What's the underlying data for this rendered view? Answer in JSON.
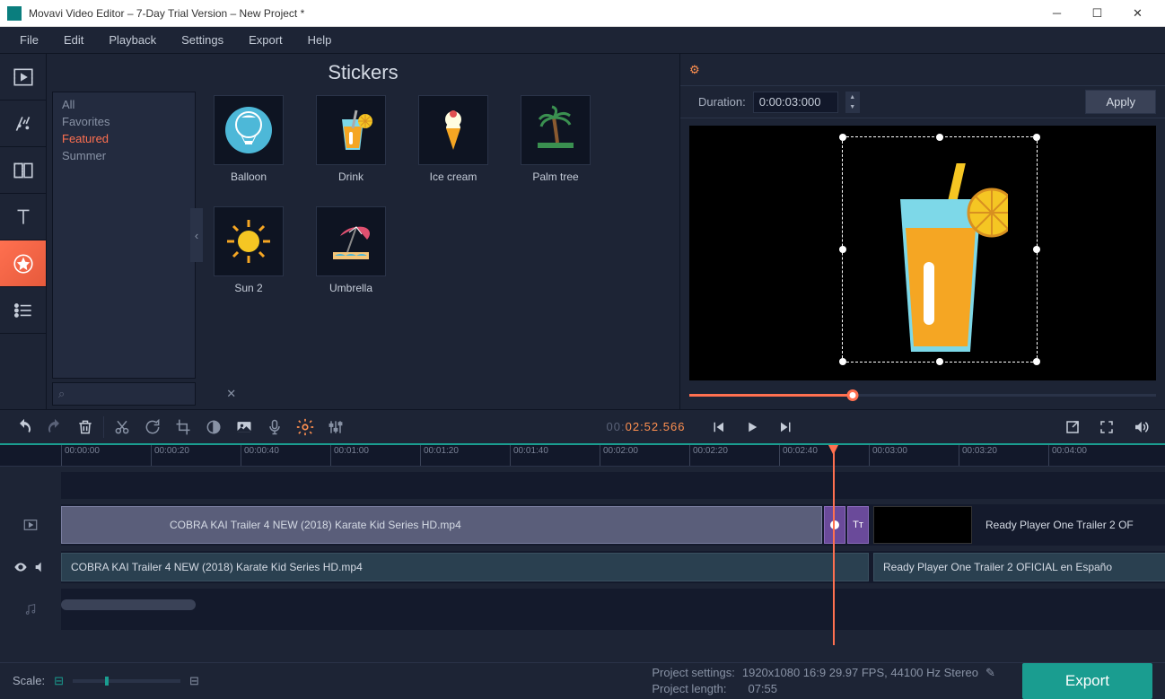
{
  "window": {
    "title": "Movavi Video Editor – 7-Day Trial Version – New Project *"
  },
  "menu": {
    "items": [
      "File",
      "Edit",
      "Playback",
      "Settings",
      "Export",
      "Help"
    ]
  },
  "panel": {
    "title": "Stickers",
    "categories": [
      "All",
      "Favorites",
      "Featured",
      "Summer"
    ],
    "active_category": 2,
    "stickers": [
      "Balloon",
      "Drink",
      "Ice cream",
      "Palm tree",
      "Sun 2",
      "Umbrella"
    ]
  },
  "preview": {
    "duration_label": "Duration:",
    "duration_value": "0:00:03:000",
    "apply": "Apply"
  },
  "timecode": {
    "gray": "00:",
    "orange": "02:52.566"
  },
  "ruler": [
    "00:00:00",
    "00:00:20",
    "00:00:40",
    "00:01:00",
    "00:01:20",
    "00:01:40",
    "00:02:00",
    "00:02:20",
    "00:02:40",
    "00:03:00",
    "00:03:20",
    "00:04:00"
  ],
  "clips": {
    "video1": "COBRA KAI Trailer 4 NEW (2018) Karate Kid Series HD.mp4",
    "video2": "Ready Player One   Trailer 2 OF",
    "audio1": "COBRA KAI Trailer 4 NEW (2018) Karate Kid Series HD.mp4",
    "audio2": "Ready Player One   Trailer 2 OFICIAL en Españo"
  },
  "status": {
    "scale_label": "Scale:",
    "settings_label": "Project settings:",
    "settings_value": "1920x1080 16:9 29.97 FPS, 44100 Hz Stereo",
    "length_label": "Project length:",
    "length_value": "07:55",
    "export": "Export"
  }
}
